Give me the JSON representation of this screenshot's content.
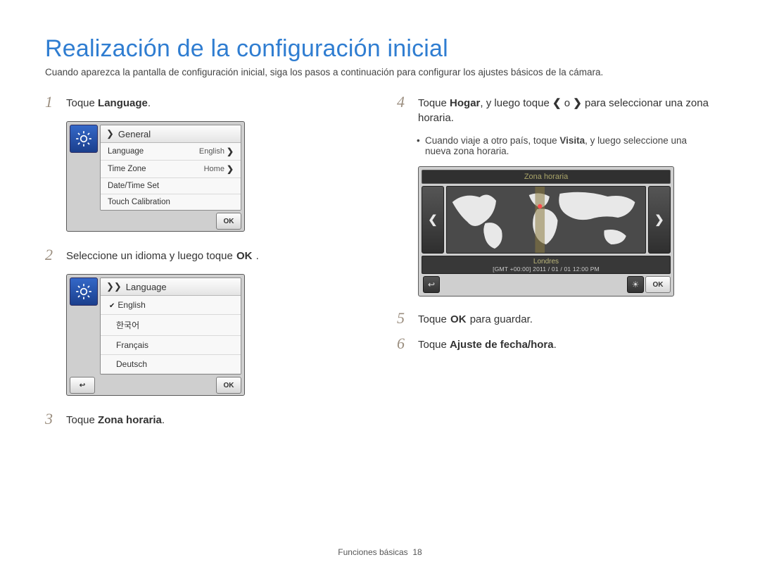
{
  "title": "Realización de la configuración inicial",
  "intro": "Cuando aparezca la pantalla de configuración inicial, siga los pasos a continuación para configurar los ajustes básicos de la cámara.",
  "steps": {
    "s1_pre": "Toque ",
    "s1_b": "Language",
    "s1_post": ".",
    "s2_pre": "Seleccione un idioma y luego toque ",
    "s2_post": " .",
    "s3_pre": "Toque ",
    "s3_b": "Zona horaria",
    "s3_post": ".",
    "s4_pre": "Toque ",
    "s4_b": "Hogar",
    "s4_mid": ", y luego toque ",
    "s4_or": " o ",
    "s4_post": " para seleccionar una zona horaria.",
    "s4_sub_pre": "Cuando viaje a otro país, toque ",
    "s4_sub_b": "Visita",
    "s4_sub_post": ", y luego seleccione una nueva zona horaria.",
    "s5_pre": "Toque ",
    "s5_post": " para guardar.",
    "s6_pre": "Toque ",
    "s6_b": "Ajuste de fecha/hora",
    "s6_post": "."
  },
  "ok_label": "OK",
  "panelA": {
    "header": "General",
    "row1_label": "Language",
    "row1_value": "English",
    "row2_label": "Time Zone",
    "row2_value": "Home",
    "row3_label": "Date/Time Set",
    "row4_label": "Touch Calibration",
    "ok": "OK"
  },
  "panelB": {
    "header": "Language",
    "opt1": "English",
    "opt2": "한국어",
    "opt3": "Français",
    "opt4": "Deutsch",
    "ok": "OK"
  },
  "tz": {
    "title": "Zona horaria",
    "city": "Londres",
    "gmt": "[GMT +00:00]   2011 / 01 / 01   12:00 PM",
    "ok": "OK"
  },
  "footer_label": "Funciones básicas",
  "footer_page": "18"
}
